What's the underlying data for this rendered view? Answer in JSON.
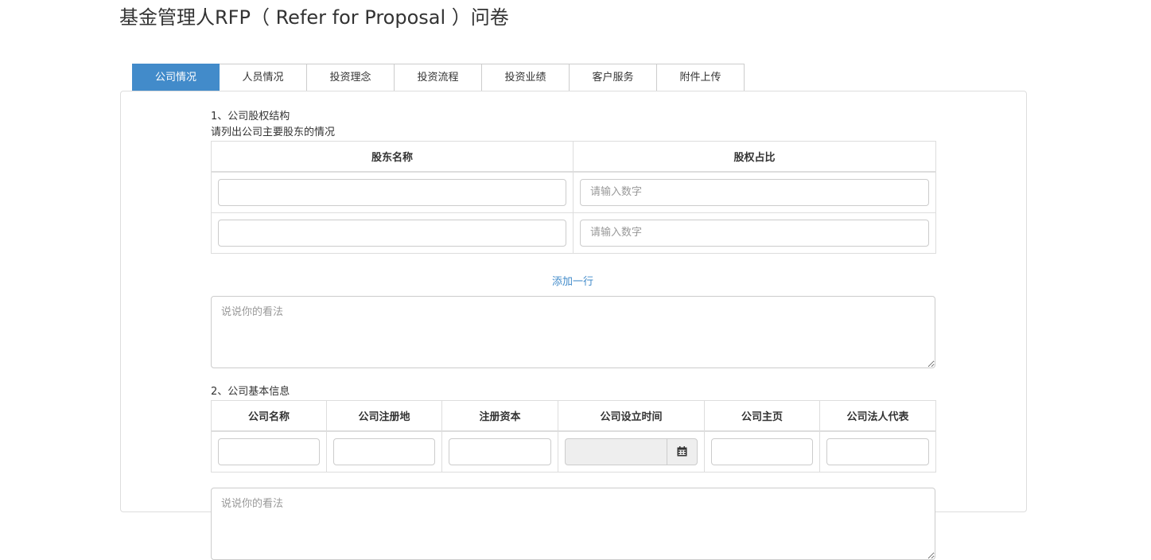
{
  "page": {
    "title": "基金管理人RFP（ Refer for Proposal ）问卷"
  },
  "tabs": [
    {
      "label": "公司情况",
      "active": true
    },
    {
      "label": "人员情况",
      "active": false
    },
    {
      "label": "投资理念",
      "active": false
    },
    {
      "label": "投资流程",
      "active": false
    },
    {
      "label": "投资业绩",
      "active": false
    },
    {
      "label": "客户服务",
      "active": false
    },
    {
      "label": "附件上传",
      "active": false
    }
  ],
  "section1": {
    "title": "1、公司股权结构",
    "subtitle": "请列出公司主要股东的情况",
    "columns": [
      "股东名称",
      "股权占比"
    ],
    "rows": [
      {
        "name": "",
        "ratio": "",
        "ratio_placeholder": "请输入数字"
      },
      {
        "name": "",
        "ratio": "",
        "ratio_placeholder": "请输入数字"
      }
    ],
    "add_row_label": "添加一行",
    "opinion_placeholder": "说说你的看法"
  },
  "section2": {
    "title": "2、公司基本信息",
    "columns": [
      "公司名称",
      "公司注册地",
      "注册资本",
      "公司设立时间",
      "公司主页",
      "公司法人代表"
    ],
    "opinion_placeholder": "说说你的看法"
  },
  "colors": {
    "accent": "#428bca",
    "border": "#dddddd",
    "disabled_bg": "#eeeeee"
  },
  "icons": {
    "date_picker": "calendar-icon",
    "textarea_resize": "resize-grip-icon"
  }
}
